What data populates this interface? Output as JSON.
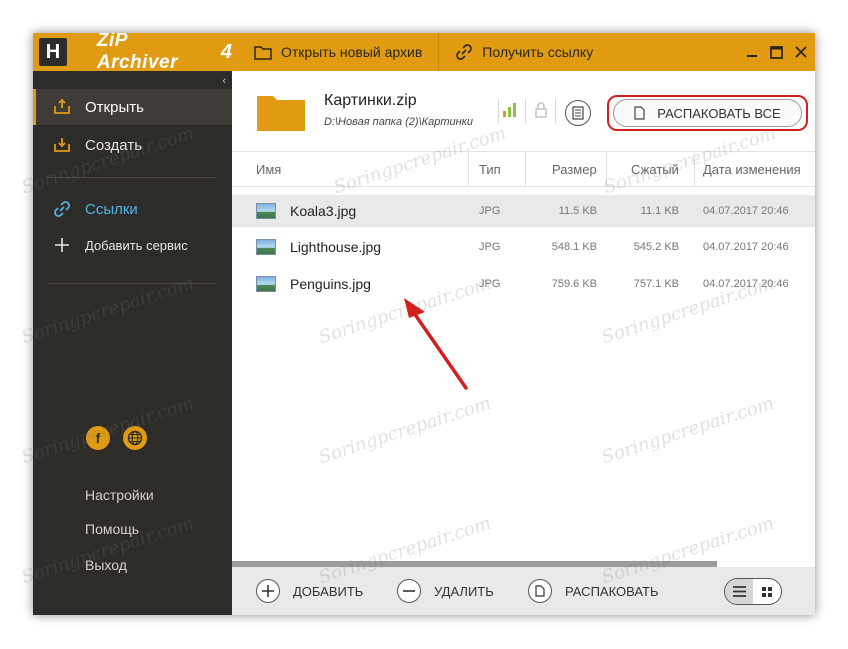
{
  "app": {
    "logo_letter": "H",
    "name": "ZiP Archiver",
    "version": "4",
    "accent_color": "#e19b12",
    "sidebar_color": "#2e2c28"
  },
  "sidebar": {
    "collapse_glyph": "‹",
    "items": [
      {
        "label": "Открыть",
        "icon": "open-tray-icon",
        "active": true
      },
      {
        "label": "Создать",
        "icon": "create-tray-icon",
        "active": false
      },
      {
        "label": "Ссылки",
        "icon": "link-icon",
        "active": false
      },
      {
        "label": "Добавить сервис",
        "icon": "plus-icon",
        "active": false
      }
    ],
    "social": [
      "facebook-icon",
      "globe-icon"
    ],
    "bottom_links": [
      "Настройки",
      "Помощь",
      "Выход"
    ]
  },
  "topbar": {
    "open_new_archive": "Открыть новый архив",
    "get_link": "Получить ссылку"
  },
  "archive": {
    "name": "Картинки.zip",
    "path": "D:\\Новая папка (2)\\Картинки",
    "extract_all": "РАСПАКОВАТЬ ВСЕ"
  },
  "table": {
    "columns": [
      "Имя",
      "Тип",
      "Размер",
      "Сжатый",
      "Дата изменения"
    ],
    "rows": [
      {
        "name": "Koala3.jpg",
        "type": "JPG",
        "size": "11.5 KB",
        "compressed": "11.1 KB",
        "date": "04.07.2017 20:46",
        "selected": true
      },
      {
        "name": "Lighthouse.jpg",
        "type": "JPG",
        "size": "548.1 KB",
        "compressed": "545.2 KB",
        "date": "04.07.2017 20:46",
        "selected": false
      },
      {
        "name": "Penguins.jpg",
        "type": "JPG",
        "size": "759.6 KB",
        "compressed": "757.1 KB",
        "date": "04.07.2017 20:46",
        "selected": false
      }
    ]
  },
  "bottombar": {
    "add": "ДОБАВИТЬ",
    "delete": "УДАЛИТЬ",
    "extract": "РАСПАКОВАТЬ",
    "view_mode": "list"
  },
  "watermark": "Soringpcrepair.com",
  "annotation_color": "#d41f1f"
}
